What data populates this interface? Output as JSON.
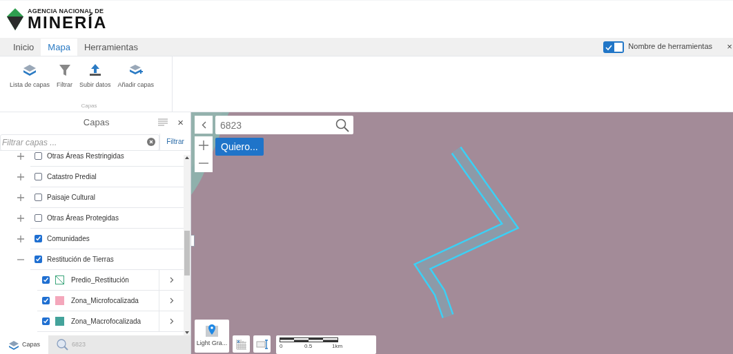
{
  "logo": {
    "line1": "AGENCIA NACIONAL DE",
    "line2": "MINERÍA"
  },
  "tabs": [
    {
      "label": "Inicio",
      "selected": false
    },
    {
      "label": "Mapa",
      "selected": true
    },
    {
      "label": "Herramientas",
      "selected": false
    }
  ],
  "toolbar_toggle": {
    "label": "Nombre de herramientas",
    "on": true,
    "close": "×"
  },
  "ribbon": {
    "group": "Capas",
    "buttons": [
      {
        "kind": "layers",
        "label": "Lista de capas"
      },
      {
        "kind": "filter",
        "label": "Filtrar"
      },
      {
        "kind": "upload",
        "label": "Subir datos"
      },
      {
        "kind": "add",
        "label": "Añadir capas"
      }
    ]
  },
  "panel": {
    "title": "Capas",
    "close": "×",
    "filter": {
      "placeholder": "Filtrar capas ...",
      "button": "Filtrar"
    },
    "layers": [
      {
        "label": "Otras Áreas Restringidas",
        "checked": false,
        "expanded": false
      },
      {
        "label": "Catastro Predial",
        "checked": false,
        "expanded": false
      },
      {
        "label": "Paisaje Cultural",
        "checked": false,
        "expanded": false
      },
      {
        "label": "Otras Áreas Protegidas",
        "checked": false,
        "expanded": false
      },
      {
        "label": "Comunidades",
        "checked": true,
        "expanded": false
      },
      {
        "label": "Restitución de Tierras",
        "checked": true,
        "expanded": true,
        "children": [
          {
            "label": "Predio_Restitución",
            "checked": true,
            "kind": "hatch",
            "color": "#3aa57a"
          },
          {
            "label": "Zona_Microfocalizada",
            "checked": true,
            "kind": "fill",
            "color": "#f4a7bb"
          },
          {
            "label": "Zona_Macrofocalizada",
            "checked": true,
            "kind": "fill",
            "color": "#44a39b"
          }
        ]
      }
    ],
    "bottom_tabs": [
      {
        "kind": "layers",
        "label": "Capas",
        "selected": true
      },
      {
        "kind": "search",
        "label": "6823",
        "selected": false
      }
    ]
  },
  "map": {
    "search": {
      "value": "6823"
    },
    "button": "Quiero...",
    "basemap": "Light Gra...",
    "scale": {
      "ticks": [
        "0",
        "0.5",
        "1km"
      ]
    }
  }
}
